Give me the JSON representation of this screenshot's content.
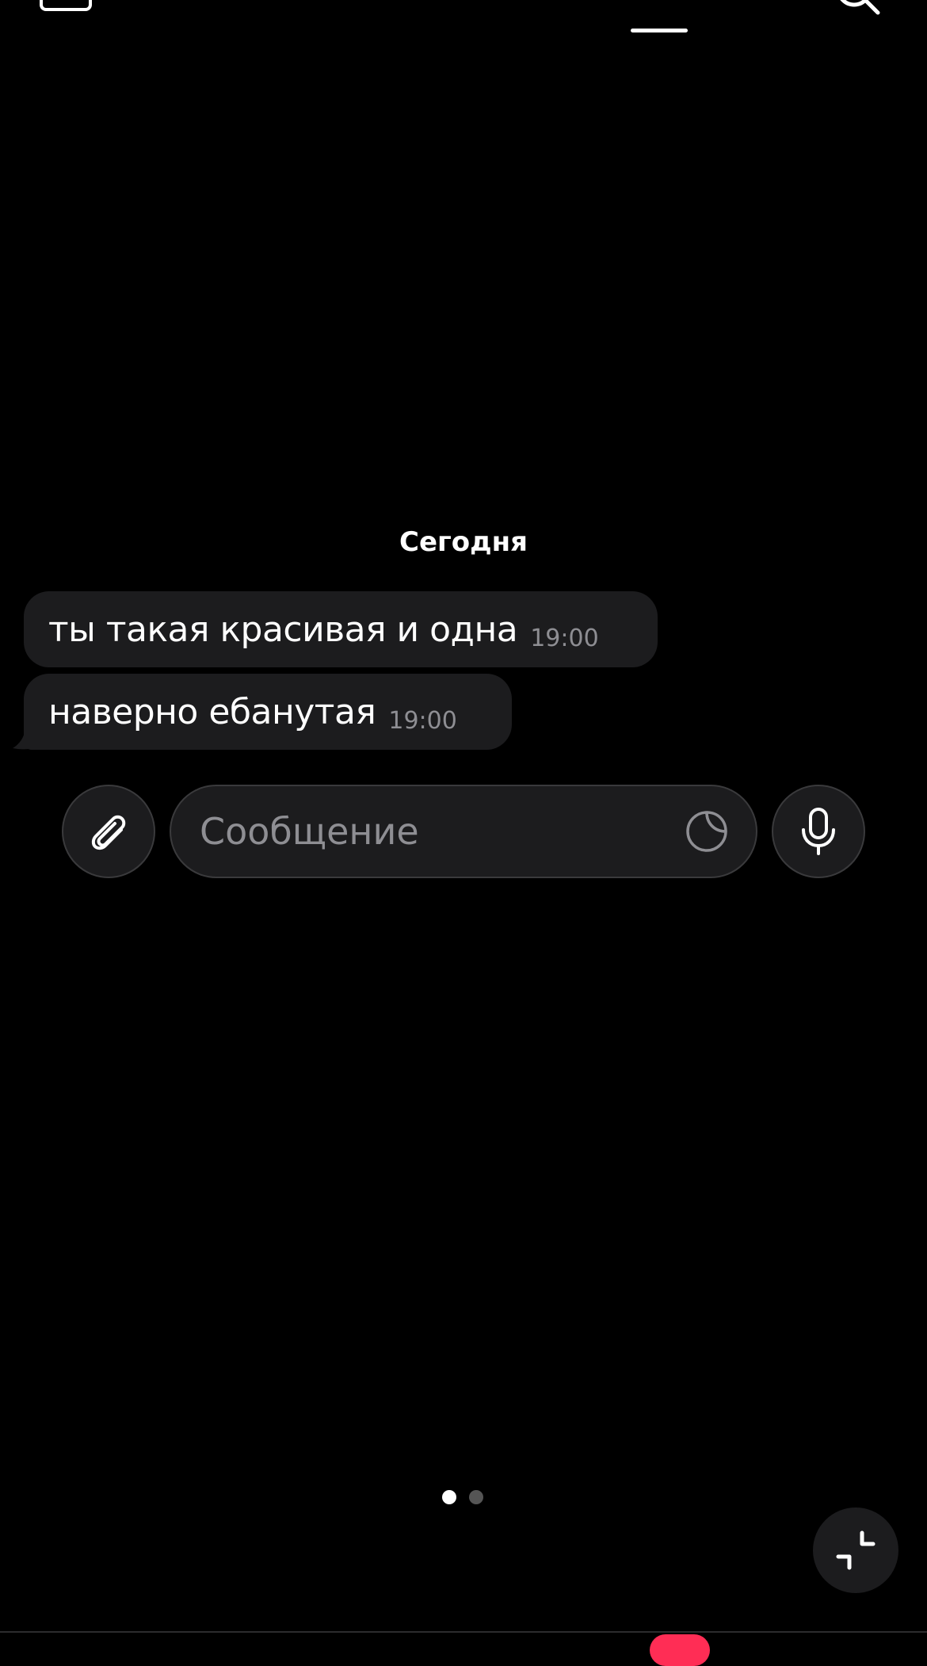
{
  "chat": {
    "date_header": "Сегодня",
    "messages": [
      {
        "text": "ты такая красивая и одна",
        "time": "19:00"
      },
      {
        "text": "наверно ебанутая",
        "time": "19:00"
      }
    ]
  },
  "composer": {
    "placeholder": "Сообщение",
    "attach_icon": "paperclip-icon",
    "sticker_icon": "sticker-icon",
    "mic_icon": "microphone-icon"
  },
  "pager": {
    "current_page": 1,
    "total_pages": 2
  },
  "colors": {
    "background": "#000000",
    "bubble": "#1c1c1e",
    "secondary_text": "#8e8e93",
    "badge": "#ff2d55"
  }
}
